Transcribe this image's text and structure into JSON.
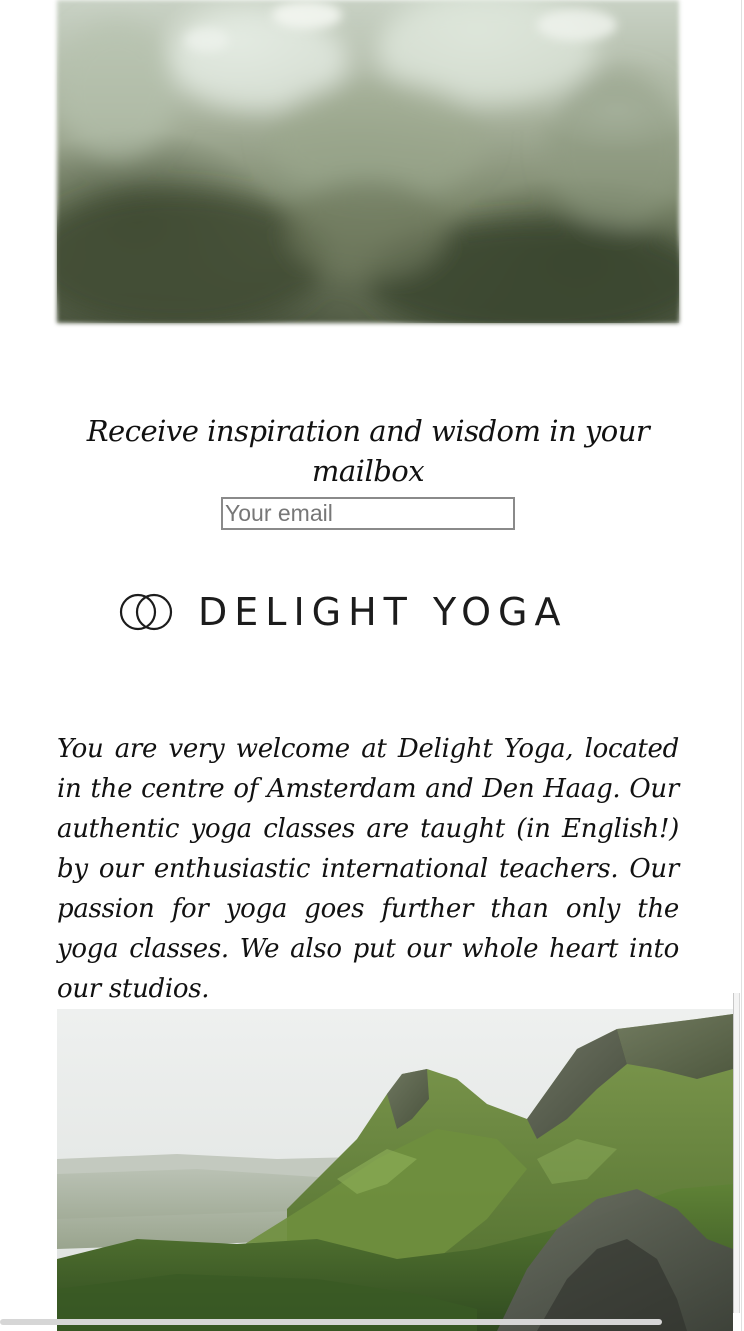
{
  "hero": {
    "image_alt": "blurred green foliage"
  },
  "newsletter": {
    "heading": "Receive inspiration and wisdom in your mailbox",
    "email_placeholder": "Your email",
    "email_value": ""
  },
  "logo": {
    "text": "DELIGHT YOGA",
    "icon": "interlocking-rings-icon"
  },
  "welcome": {
    "text": "You are very welcome at Delight Yoga, located in the centre of Amsterdam and Den Haag. Our authentic yoga classes are taught (in English!) by our enthusiastic international teachers. Our passion for yoga goes further than only the yoga classes. We also put our whole heart into our studios."
  },
  "landscape": {
    "image_alt": "green mountain cliffs under a misty sky"
  },
  "colors": {
    "text": "#111111",
    "logo": "#1c1c1c",
    "input_border": "#8a8a8a"
  }
}
